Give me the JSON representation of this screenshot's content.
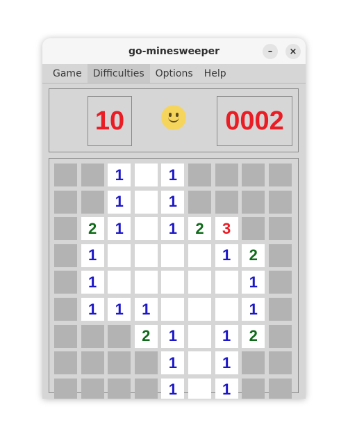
{
  "window": {
    "title": "go-minesweeper"
  },
  "titlebar_buttons": {
    "minimize": "–",
    "close": "×"
  },
  "menu": {
    "items": [
      "Game",
      "Difficulties",
      "Options",
      "Help"
    ],
    "active_index": 1
  },
  "status": {
    "mines_left": "10",
    "timer": "0002",
    "face": "smiley"
  },
  "colors": {
    "number_1": "#1c17c8",
    "number_2": "#0f6a1a",
    "number_3": "#ea1c24",
    "counter": "#ea1c24",
    "hidden_cell": "#b3b3b3",
    "open_cell": "#ffffff"
  },
  "board": {
    "rows": [
      [
        "#",
        "#",
        "1",
        " ",
        "1",
        "#",
        "#",
        "#",
        "#"
      ],
      [
        "#",
        "#",
        "1",
        " ",
        "1",
        "#",
        "#",
        "#",
        "#"
      ],
      [
        "#",
        "2",
        "1",
        " ",
        "1",
        "2",
        "3",
        "#",
        "#"
      ],
      [
        "#",
        "1",
        " ",
        " ",
        " ",
        " ",
        "1",
        "2",
        "#"
      ],
      [
        "#",
        "1",
        " ",
        " ",
        " ",
        " ",
        " ",
        "1",
        "#"
      ],
      [
        "#",
        "1",
        "1",
        "1",
        " ",
        " ",
        " ",
        "1",
        "#"
      ],
      [
        "#",
        "#",
        "#",
        "2",
        "1",
        " ",
        "1",
        "2",
        "#"
      ],
      [
        "#",
        "#",
        "#",
        "#",
        "1",
        " ",
        "1",
        "#",
        "#"
      ],
      [
        "#",
        "#",
        "#",
        "#",
        "1",
        " ",
        "1",
        "#",
        "#"
      ]
    ]
  }
}
